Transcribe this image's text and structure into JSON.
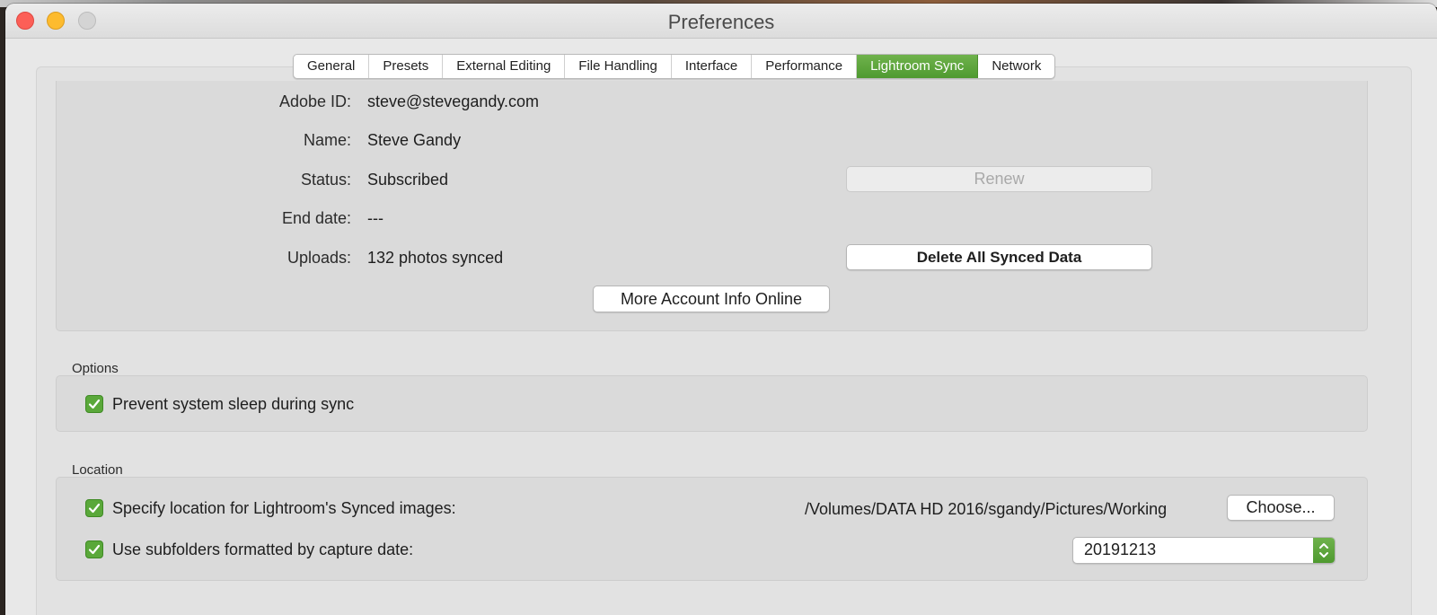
{
  "window": {
    "title": "Preferences"
  },
  "tabs": [
    {
      "label": "General"
    },
    {
      "label": "Presets"
    },
    {
      "label": "External Editing"
    },
    {
      "label": "File Handling"
    },
    {
      "label": "Interface"
    },
    {
      "label": "Performance"
    },
    {
      "label": "Lightroom Sync",
      "active": true
    },
    {
      "label": "Network"
    }
  ],
  "account": {
    "adobe_id_label": "Adobe ID:",
    "adobe_id": "steve@stevegandy.com",
    "name_label": "Name:",
    "name": "Steve Gandy",
    "status_label": "Status:",
    "status": "Subscribed",
    "end_date_label": "End date:",
    "end_date": "---",
    "uploads_label": "Uploads:",
    "uploads": "132 photos synced",
    "renew_button": "Renew",
    "delete_button": "Delete All Synced Data",
    "more_info_button": "More Account Info Online"
  },
  "options": {
    "title": "Options",
    "prevent_sleep_label": "Prevent system sleep during sync",
    "prevent_sleep_checked": true
  },
  "location": {
    "title": "Location",
    "specify_label": "Specify location for Lightroom's Synced images:",
    "specify_checked": true,
    "path": "/Volumes/DATA HD 2016/sgandy/Pictures/Working",
    "choose_button": "Choose...",
    "subfolders_label": "Use subfolders formatted by capture date:",
    "subfolders_checked": true,
    "date_format": "20191213"
  },
  "colors": {
    "accent_green": "#5aa83a",
    "close": "#fc5f57",
    "minimize": "#fdbb2e",
    "zoom_inactive": "#d4d4d4"
  }
}
